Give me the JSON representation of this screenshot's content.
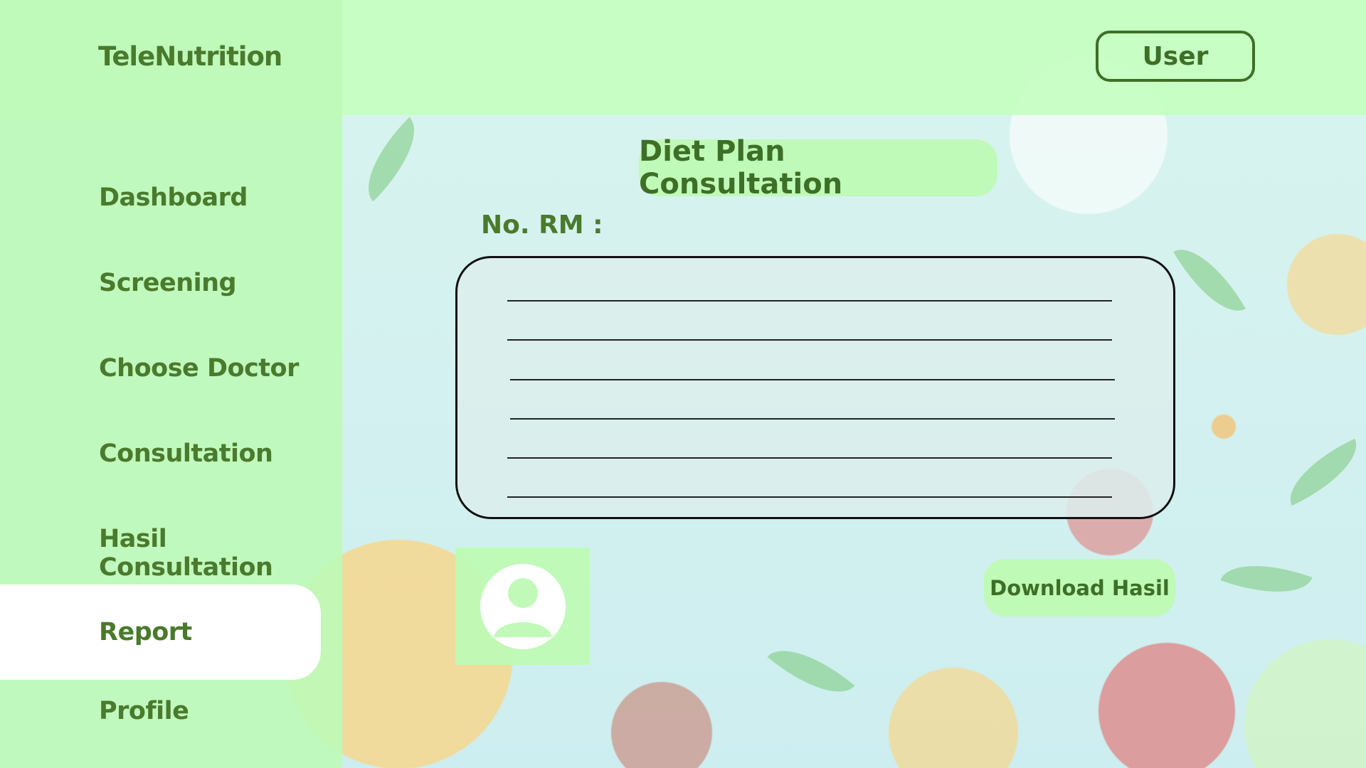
{
  "app": {
    "brand": "TeleNutrition"
  },
  "header": {
    "user_label": "User"
  },
  "sidebar": {
    "items": [
      {
        "label": "Dashboard"
      },
      {
        "label": "Screening"
      },
      {
        "label": "Choose Doctor"
      },
      {
        "label": "Consultation"
      },
      {
        "label": "Hasil Consultation"
      },
      {
        "label": "Report"
      },
      {
        "label": "Profile"
      }
    ],
    "active": "Report"
  },
  "main": {
    "title": "Diet Plan Consultation",
    "rm_label": "No. RM :",
    "notes": [
      "",
      "",
      "",
      "",
      "",
      ""
    ],
    "download_label": "Download Hasil",
    "avatar_icon": "user-avatar-icon"
  },
  "colors": {
    "accent_green": "#3e6f27",
    "panel_green": "#c4ffbe",
    "active_item": "#ffffff"
  }
}
